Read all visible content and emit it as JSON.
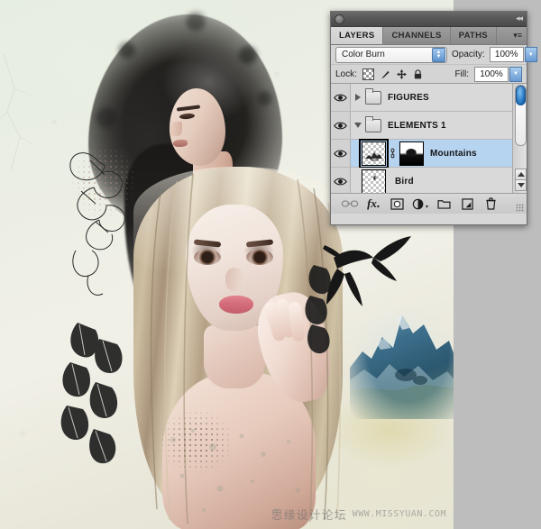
{
  "app": {
    "name": "Adobe Photoshop",
    "document_type": "photo-composite-artwork"
  },
  "panel": {
    "titlebar": {
      "collapse_icon": "double-chevron-left-icon"
    },
    "tabs": [
      {
        "label": "LAYERS",
        "active": true
      },
      {
        "label": "CHANNELS",
        "active": false
      },
      {
        "label": "PATHS",
        "active": false
      }
    ],
    "menu_icon": "panel-menu-icon",
    "blend": {
      "mode": "Color Burn",
      "opacity_label": "Opacity:",
      "opacity_value": "100%"
    },
    "lock": {
      "label": "Lock:",
      "items": [
        {
          "name": "lock-transparent-pixels-icon"
        },
        {
          "name": "lock-image-pixels-icon"
        },
        {
          "name": "lock-position-icon"
        },
        {
          "name": "lock-all-icon"
        }
      ],
      "fill_label": "Fill:",
      "fill_value": "100%"
    },
    "layers": [
      {
        "name": "FIGURES",
        "type": "group",
        "expanded": false,
        "visible": true,
        "selected": false
      },
      {
        "name": "ELEMENTS 1",
        "type": "group",
        "expanded": true,
        "visible": true,
        "selected": false
      },
      {
        "name": "Mountains",
        "type": "layer",
        "visible": true,
        "selected": true,
        "has_mask": true,
        "linked": true
      },
      {
        "name": "Bird",
        "type": "layer",
        "visible": true,
        "selected": false,
        "has_mask": false,
        "linked": false
      }
    ],
    "footer_buttons": [
      {
        "name": "link-layers-icon",
        "label": "Link layers"
      },
      {
        "name": "layer-style-fx-icon",
        "label": "fx"
      },
      {
        "name": "add-layer-mask-icon",
        "label": "Add layer mask"
      },
      {
        "name": "new-adjustment-layer-icon",
        "label": "New fill or adjustment layer"
      },
      {
        "name": "new-group-icon",
        "label": "Create a new group"
      },
      {
        "name": "new-layer-icon",
        "label": "Create a new layer"
      },
      {
        "name": "delete-layer-icon",
        "label": "Delete layer"
      }
    ],
    "scrollbar": {
      "name": "layers-vertical-scrollbar"
    }
  },
  "watermark": {
    "chinese": "思缘设计论坛",
    "url": "WWW.MISSYUAN.COM"
  },
  "colors": {
    "panel_bg": "#d7d7d7",
    "selection_blue": "#b6d3f0",
    "canvas_bg": "#bdbdbd",
    "paper": "#ecefe3",
    "mountain_blue": "#3f6f8c"
  },
  "artwork": {
    "description": "Two retouched female portraits composited on textured paper with ink-drawn birds, feathers and a watercolor mountain"
  }
}
